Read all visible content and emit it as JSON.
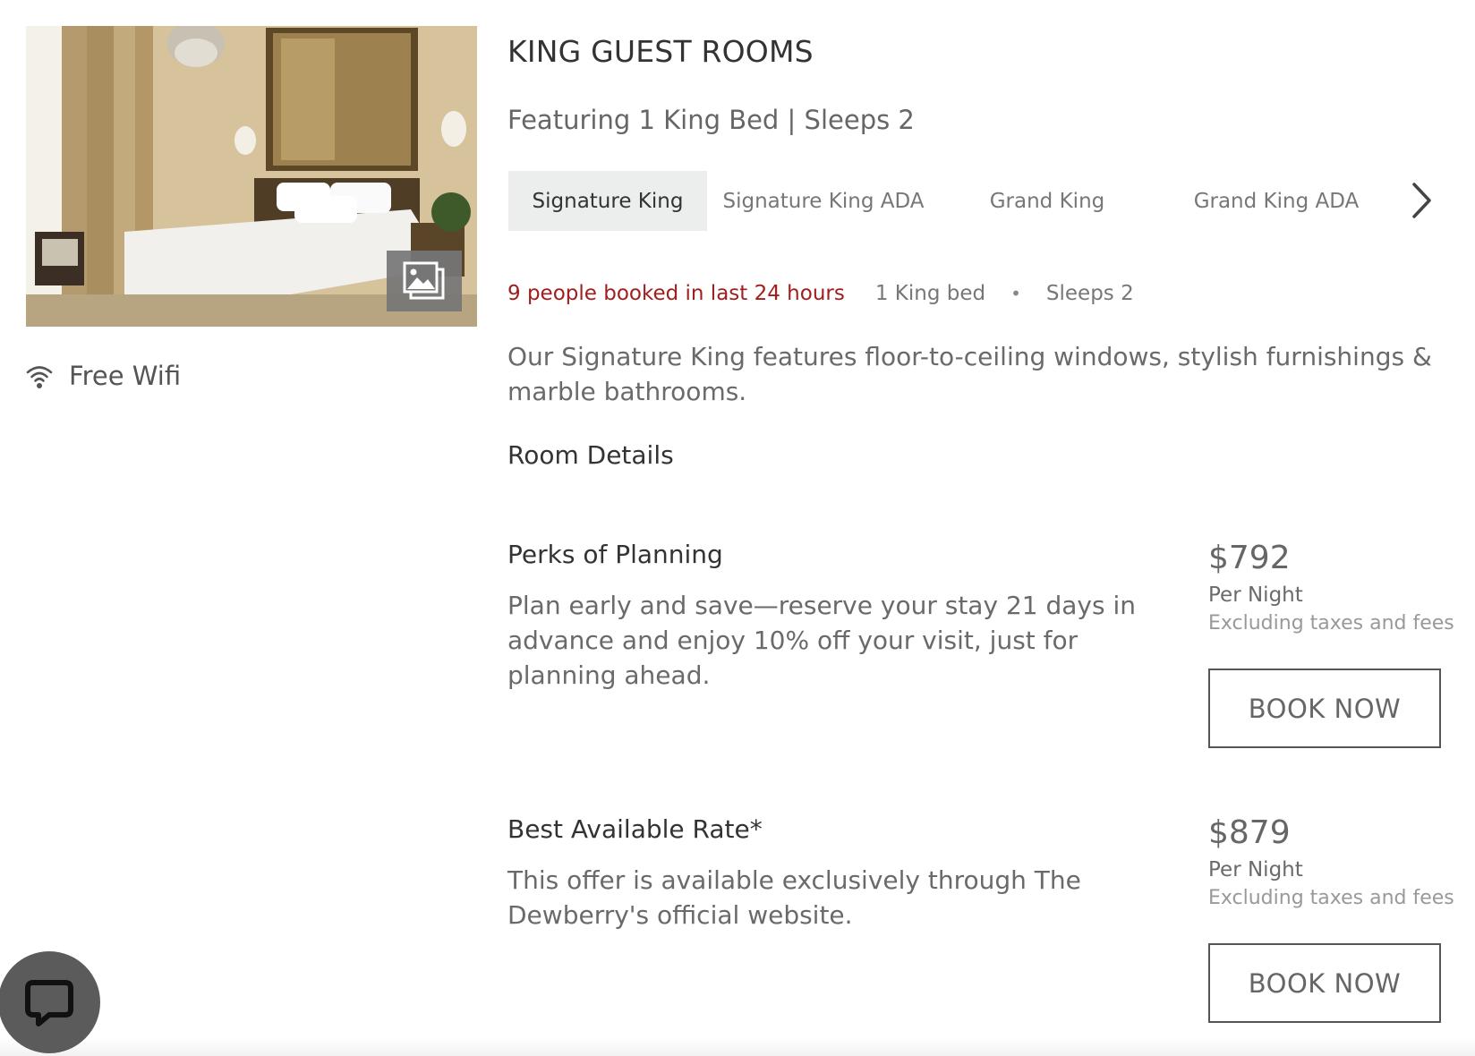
{
  "room": {
    "title": "KING GUEST ROOMS",
    "subtitle": "Featuring 1 King Bed | Sleeps 2",
    "amenities": [
      {
        "icon": "wifi-icon",
        "label": "Free Wifi"
      }
    ],
    "tabs": [
      {
        "label": "Signature King",
        "active": true
      },
      {
        "label": "Signature King ADA",
        "active": false
      },
      {
        "label": "Grand King",
        "active": false
      },
      {
        "label": "Grand King ADA",
        "active": false
      }
    ],
    "booked_notice": "9 people booked in last 24 hours",
    "beds": "1 King bed",
    "separator": "•",
    "sleeps": "Sleeps 2",
    "description": "Our Signature King features floor-to-ceiling windows, stylish furnishings & marble bathrooms.",
    "details_link": "Room Details"
  },
  "rates": [
    {
      "name": "Perks of Planning",
      "description": "Plan early and save—reserve your stay 21 days in advance and enjoy 10% off your visit, just for planning ahead.",
      "price": "$792",
      "per": "Per Night",
      "note": "Excluding taxes and fees",
      "button": "BOOK NOW"
    },
    {
      "name": "Best Available Rate*",
      "description": "This offer is available exclusively through The Dewberry's official website.",
      "price": "$879",
      "per": "Per Night",
      "note": "Excluding taxes and fees",
      "button": "BOOK NOW"
    }
  ],
  "colors": {
    "booked_red": "#a01e1e",
    "active_tab_bg": "#eceded",
    "chat_bg": "#5b5b5b"
  }
}
